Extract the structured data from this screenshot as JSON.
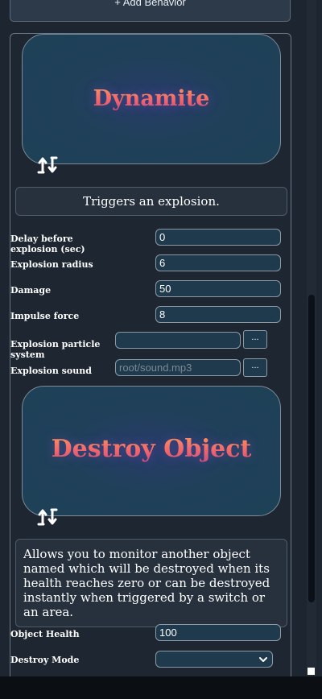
{
  "top_button": {
    "label": "+ Add Behavior"
  },
  "dynamite": {
    "title": "Dynamite",
    "description": "Triggers an explosion.",
    "icon": "swap-arrows-icon",
    "fields": [
      {
        "label": "Delay before explosion (sec)",
        "value": "0"
      },
      {
        "label": "Explosion radius",
        "value": "6"
      },
      {
        "label": "Damage",
        "value": "50"
      },
      {
        "label": "Impulse force",
        "value": "8"
      }
    ],
    "particle": {
      "label": "Explosion particle system",
      "value": "",
      "button": "..."
    },
    "sound": {
      "label": "Explosion sound",
      "placeholder": "root/sound.mp3",
      "button": "..."
    }
  },
  "destroy": {
    "title": "Destroy Object",
    "description": "Allows you to monitor another object named which will be destroyed when its health reaches zero or can be destroyed instantly when triggered by a switch or an area.",
    "icon": "swap-arrows-icon",
    "health": {
      "label": "Object Health",
      "value": "100"
    },
    "mode": {
      "label": "Destroy Mode",
      "value": ""
    }
  },
  "colors": {
    "background": "#1d2530",
    "card_gradient": "#1d4156",
    "title_gradient_start": "#ff9a52",
    "title_gradient_end": "#c84d7a",
    "input_bg": "#1e3a4c"
  }
}
